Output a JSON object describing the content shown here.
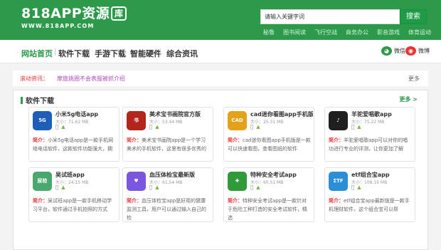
{
  "header": {
    "logo_text": "818APP资源",
    "logo_badge": "库",
    "logo_sub": "WWW.818APP.COM",
    "search_value": "请输入关键字词",
    "search_button": "搜索",
    "hot_tags": [
      "秘鲁",
      "图书阅读",
      "飞行空战",
      "商务办公",
      "影音游戏",
      "体育运动"
    ]
  },
  "nav": {
    "items": [
      "网站首页",
      "软件下载",
      "手游下载",
      "智能硬件",
      "综合资讯"
    ],
    "weixin": "微信",
    "weibo": "微博"
  },
  "news": {
    "label": "滚动资讯：",
    "text": "摩旅挑圈不会表服被抓介绍",
    "more": "更多"
  },
  "software": {
    "title": "软件下载",
    "more": "更多 >",
    "desc_prefix": "简介：",
    "cards": [
      {
        "name": "小米5g电话app",
        "size": "大小：71.62 MB",
        "desc": "小米5g电话app是一款手机网络电话软件，这款软件功能强大，拥",
        "icon_color": "#1e5db8",
        "icon_text": "5G"
      },
      {
        "name": "美术宝书画院官方版",
        "size": "大小：53.44 MB",
        "desc": "美术宝书画院app是一个学习美术的手机软件，这里有很多优秀的",
        "icon_color": "#b3261e",
        "icon_text": "书"
      },
      {
        "name": "cad迷你看图app手机版",
        "size": "大小：25.31 MB",
        "desc": "cad迷你看图app手机版是一款可以快速看图，查看图纸的软件",
        "icon_color": "#e3a21a",
        "icon_text": "CAD"
      },
      {
        "name": "羊驼爱唱歌app",
        "size": "大小：75.22 MB",
        "desc": "羊驼爱唱歌app可以对你的唱功进行专业的评测，让你更加了解",
        "icon_color": "#1f1f1f",
        "icon_text": "♪"
      },
      {
        "name": "吴试班app",
        "size": "大小：24.15 MB",
        "desc": "吴试班app是一款手机移动学习平台，软件通过手机拍照的方式",
        "icon_color": "#4aa86f",
        "icon_text": "尿检"
      },
      {
        "name": "血压体检宝最新版",
        "size": "大小：61.54 MB",
        "desc": "血压体检宝app是好用的健康监测工具，用户可以通过输入自己的检",
        "icon_color": "#7b57e0",
        "icon_text": "♥"
      },
      {
        "name": "特种安全考试app",
        "size": "大小：60.51 MB",
        "desc": "特种安全考试app是一款针对于危险工种打造的安全考试软件，精选",
        "icon_color": "#2f9a3a",
        "icon_text": "✚"
      },
      {
        "name": "etf组合宝app",
        "size": "大小：108.19 MB",
        "desc": "etf组合宝app最新版是一款手机理财软件，这个组合宝可以帮",
        "icon_color": "#2a8fd6",
        "icon_text": "ΣTF"
      }
    ]
  },
  "colors": {
    "brand_green": "#2c9a4a",
    "accent_red": "#e33",
    "news_purple": "#b24bbd"
  }
}
